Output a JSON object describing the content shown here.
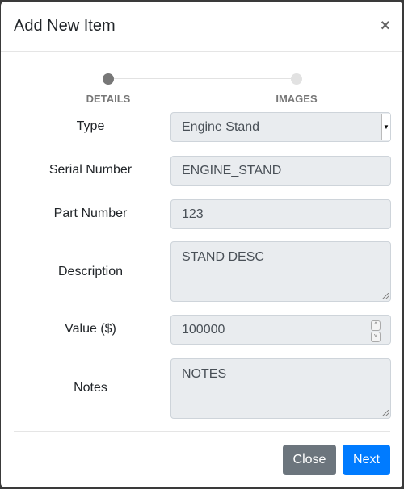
{
  "modal": {
    "title": "Add New Item",
    "close_icon": "×"
  },
  "stepper": {
    "steps": [
      {
        "label": "DETAILS",
        "active": true
      },
      {
        "label": "IMAGES",
        "active": false
      }
    ],
    "active_color": "#777777",
    "inactive_color": "#e2e2e2"
  },
  "form": {
    "type": {
      "label": "Type",
      "value": "Engine Stand"
    },
    "serial": {
      "label": "Serial Number",
      "value": "ENGINE_STAND"
    },
    "part": {
      "label": "Part Number",
      "value": "123"
    },
    "description": {
      "label": "Description",
      "value": "STAND DESC"
    },
    "value": {
      "label": "Value ($)",
      "value": "100000"
    },
    "notes": {
      "label": "Notes",
      "value": "NOTES"
    }
  },
  "footer": {
    "close_label": "Close",
    "next_label": "Next",
    "close_color": "#6c757d",
    "next_color": "#007bff"
  }
}
